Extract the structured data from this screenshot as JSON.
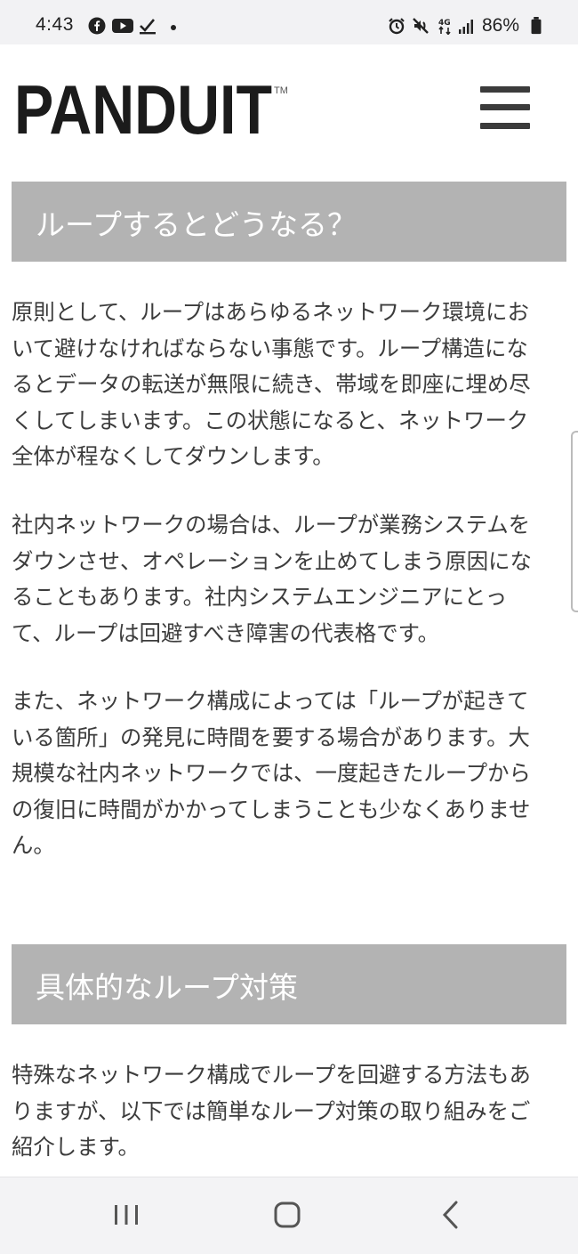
{
  "status_bar": {
    "time": "4:43",
    "battery": "86%",
    "left_icons": [
      "facebook-icon",
      "youtube-icon",
      "task-done-icon",
      "dot-icon"
    ],
    "right_icons": [
      "alarm-icon",
      "mute-icon",
      "network-4g-icon",
      "signal-icon",
      "battery-icon"
    ]
  },
  "header": {
    "logo_text": "PANDUIT",
    "logo_tm": "TM",
    "menu_icon": "hamburger-menu-icon"
  },
  "sections": [
    {
      "heading": "ループするとどうなる？",
      "paragraphs": [
        {
          "lines": [
            "原則として、ループはあらゆるネットワーク環境にお",
            "いて避けなければならない事態です。ループ構造にな",
            "るとデータの転送が無限に続き、帯域を即座に埋め尽",
            "くしてしまいます。この状態になると、ネットワーク",
            "全体が程なくしてダウンします。"
          ]
        },
        {
          "lines": [
            "社内ネットワークの場合は、ループが業務システムを",
            "ダウンさせ、オペレーションを止めてしまう原因にな",
            "ることもあります。社内システムエンジニアにとっ",
            "て、ループは回避すべき障害の代表格です。"
          ]
        },
        {
          "lines": [
            "また、ネットワーク構成によっては「ループが起きて",
            "いる箇所」の発見に時間を要する場合があります。大",
            "規模な社内ネットワークでは、一度起きたループから",
            "の復旧に時間がかかってしまうことも少なくありませ",
            "ん。"
          ]
        }
      ]
    },
    {
      "heading": "具体的なループ対策",
      "paragraphs": [
        {
          "lines": [
            "特殊なネットワーク構成でループを回避する方法もあ",
            "りますが、以下では簡単なループ対策の取り組みをご",
            "紹介します。"
          ]
        }
      ]
    }
  ],
  "nav_bar": {
    "recents_icon": "recent-apps-icon",
    "home_icon": "home-icon",
    "back_icon": "back-icon"
  },
  "colors": {
    "heading_bg": "#b3b3b3",
    "heading_text": "#ffffff",
    "body_text": "#3c3c3c",
    "logo": "#1b1b1b"
  }
}
